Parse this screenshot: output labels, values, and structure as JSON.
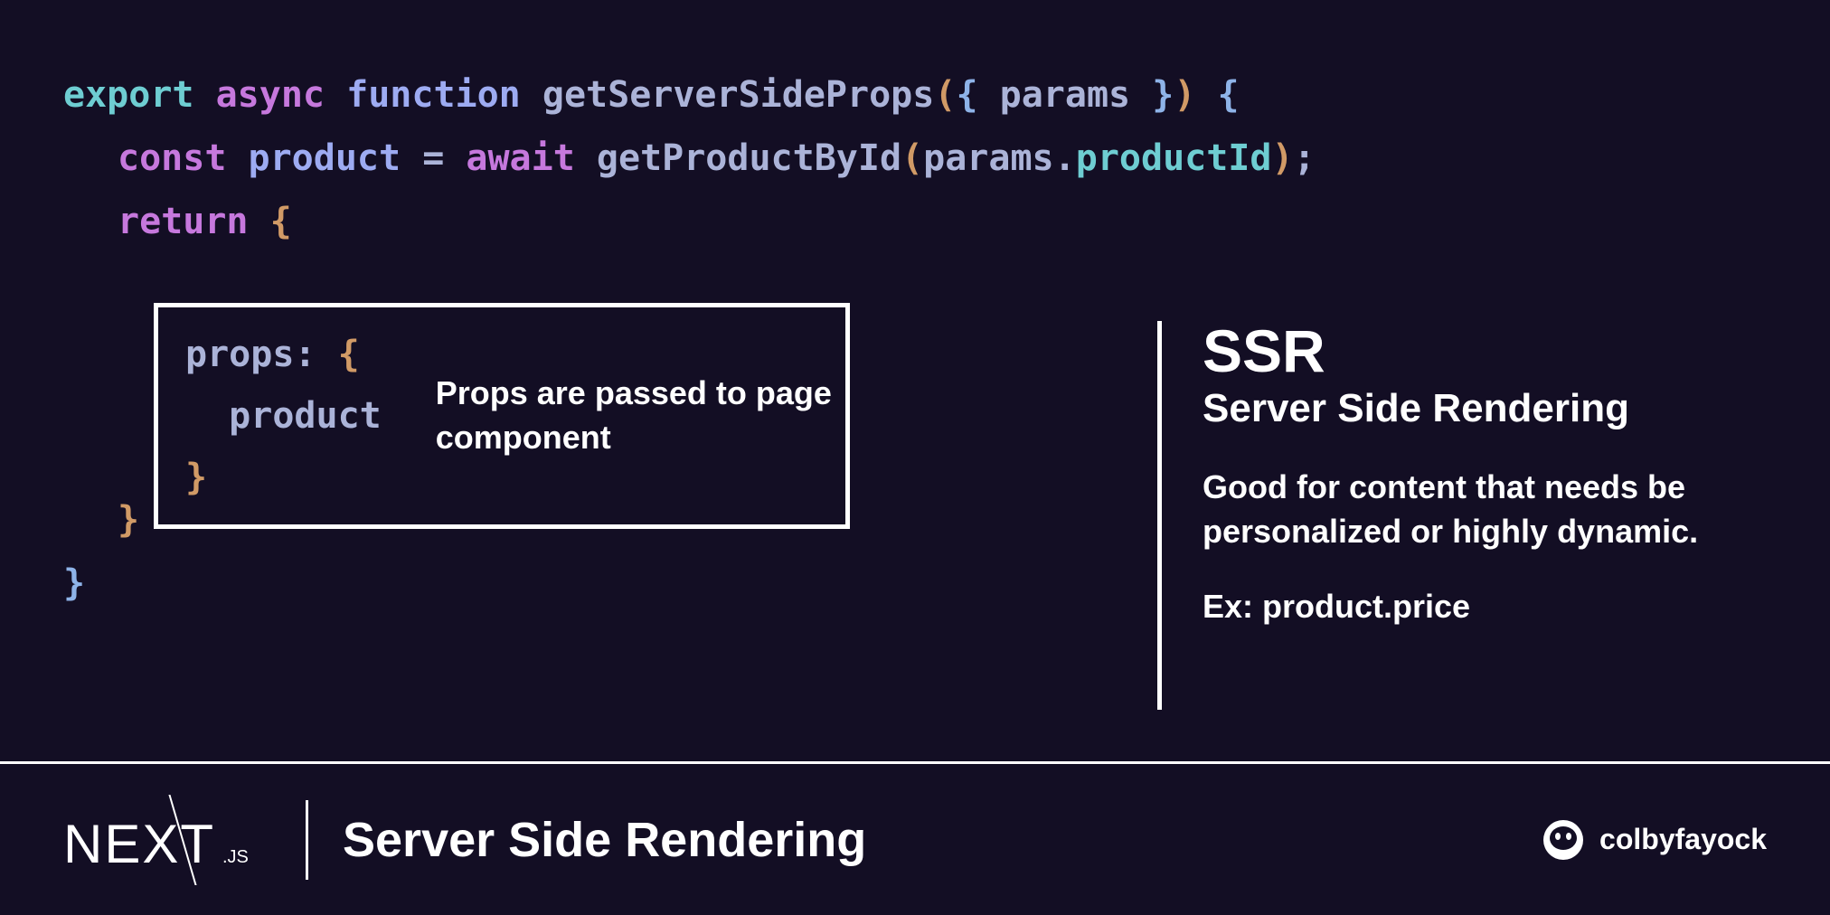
{
  "code": {
    "line1": {
      "export": "export",
      "async": "async",
      "function": "function",
      "fnName": "getServerSideProps",
      "param": "params"
    },
    "line2": {
      "const": "const",
      "varName": "product",
      "await": "await",
      "fnCall": "getProductById",
      "obj": "params",
      "member": "productId"
    },
    "line3": {
      "return": "return"
    },
    "propsBox": {
      "key": "props",
      "value": "product"
    }
  },
  "annotation": {
    "props": "Props are passed to page component"
  },
  "sidebar": {
    "heading": "SSR",
    "subheading": "Server Side Rendering",
    "description": "Good for content that needs be personalized or highly dynamic.",
    "example": "Ex: product.price"
  },
  "footer": {
    "logoText": "NEXT",
    "logoSuffix": ".JS",
    "title": "Server Side Rendering",
    "creditName": "colbyfayock"
  }
}
